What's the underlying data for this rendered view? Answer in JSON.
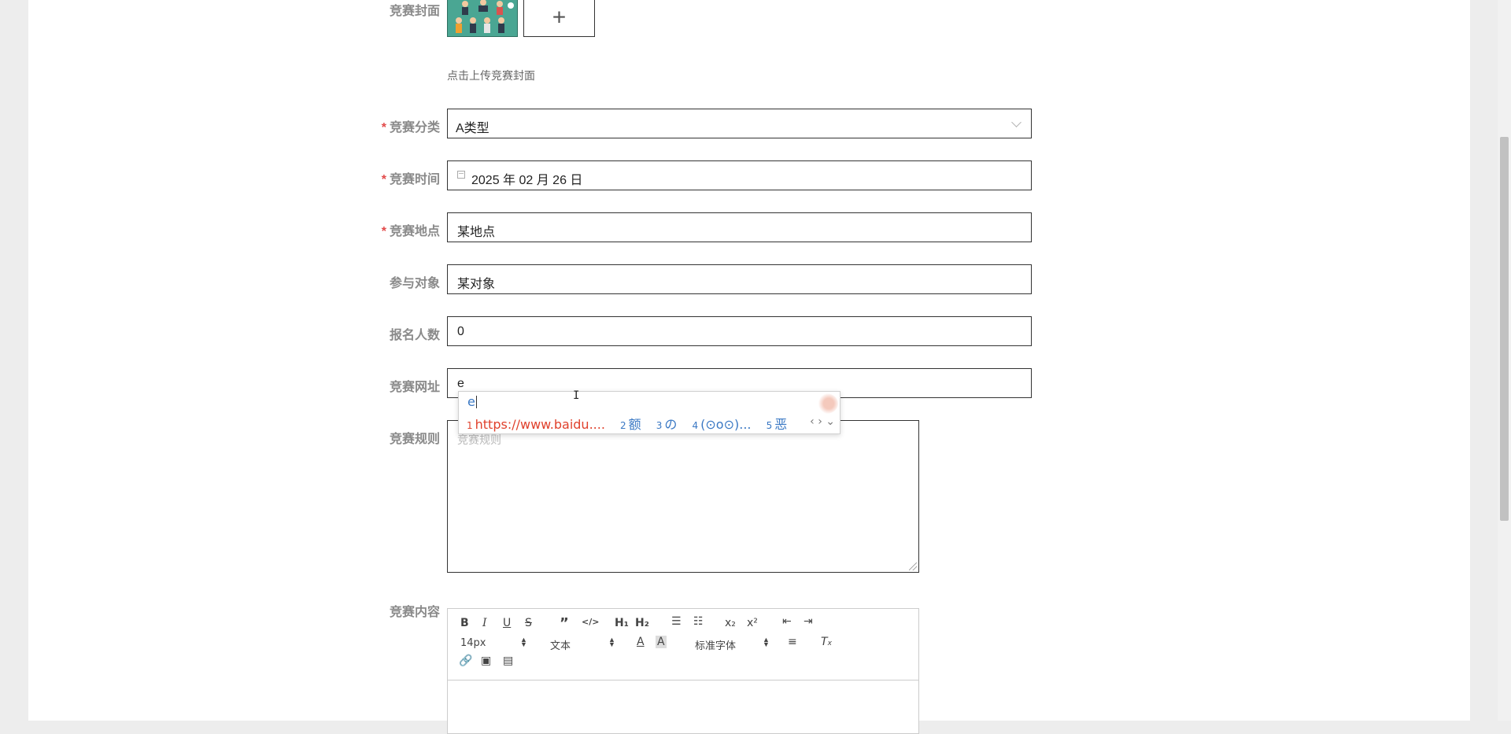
{
  "form": {
    "cover": {
      "label": "竞赛封面",
      "hint": "点击上传竞赛封面",
      "upload_symbol": "+"
    },
    "category": {
      "label": "竞赛分类",
      "required_mark": "*",
      "value": "A类型"
    },
    "time": {
      "label": "竞赛时间",
      "required_mark": "*",
      "value": "2025 年 02 月 26 日"
    },
    "location": {
      "label": "竞赛地点",
      "required_mark": "*",
      "value": "某地点"
    },
    "participants": {
      "label": "参与对象",
      "value": "某对象"
    },
    "signup_count": {
      "label": "报名人数",
      "value": "0"
    },
    "website": {
      "label": "竞赛网址",
      "value": "e"
    },
    "rules": {
      "label": "竞赛规则",
      "placeholder": "竞赛规则"
    },
    "content": {
      "label": "竞赛内容"
    }
  },
  "ime": {
    "input": "e",
    "candidates": [
      {
        "num": "1",
        "text": "https://www.baidu...."
      },
      {
        "num": "2",
        "text": "额"
      },
      {
        "num": "3",
        "text": "の"
      },
      {
        "num": "4",
        "text": "(⊙o⊙)..."
      },
      {
        "num": "5",
        "text": "恶"
      }
    ],
    "nav": "‹ › ⌄"
  },
  "editor": {
    "font_size": "14px",
    "heading": "文本",
    "font_family": "标准字体",
    "h1": "H₁",
    "h2": "H₂",
    "sub": "x₂",
    "sup": "x²"
  },
  "colors": {
    "required": "#e24a4a",
    "ime_candidate": "#3a78c4",
    "ime_first": "#e0412c"
  }
}
